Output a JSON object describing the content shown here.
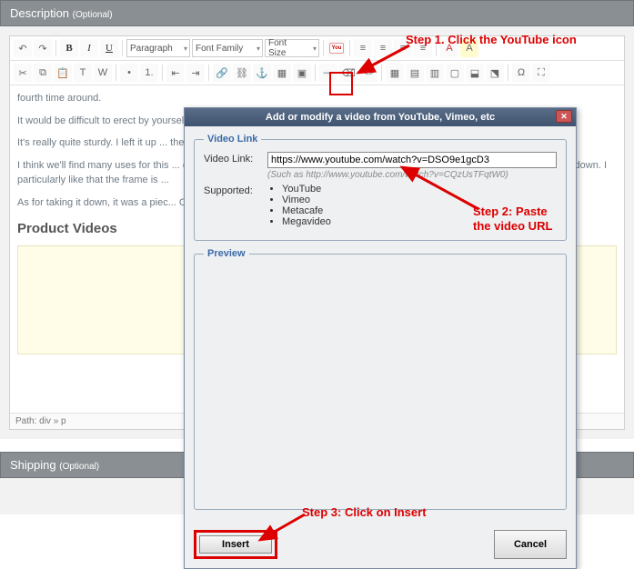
{
  "sections": {
    "description": {
      "title": "Description",
      "optional": "(Optional)"
    },
    "shipping": {
      "title": "Shipping",
      "optional": "(Optional)"
    }
  },
  "toolbar": {
    "paragraph": "Paragraph",
    "fontfamily": "Font Family",
    "fontsize": "Font Size"
  },
  "editor": {
    "p1": "fourth time around.",
    "p2": "It would be difficult to erect by yourself ...",
    "p3": "It's really quite sturdy. I left it up ... the day we erected it. Oh yes, I did stand u... might be worth investing in the walls!",
    "p4": "I think we'll find many uses for this ... of kid's birthday parties is keeping everyon... My 20 month old gave it a pretty good go... down. I particularly like that the frame is ...",
    "p5": "As for taking it down, it was a piec... Oh yes, an came. So much tidier ...",
    "product_videos": "Product Videos"
  },
  "pathbar": "Path: div » p",
  "dialog": {
    "title": "Add or modify a video from YouTube, Vimeo, etc",
    "legend_link": "Video Link",
    "label_link": "Video Link:",
    "input_value": "https://www.youtube.com/watch?v=DSO9e1gcD3",
    "hint": "(Such as http://www.youtube.com/watch?v=CQzUsTFqtW0)",
    "label_supported": "Supported:",
    "supported": [
      "YouTube",
      "Vimeo",
      "Metacafe",
      "Megavideo"
    ],
    "legend_preview": "Preview",
    "btn_insert": "Insert",
    "btn_cancel": "Cancel"
  },
  "annotations": {
    "step1": "Step 1. Click the YouTube icon",
    "step2a": "Step 2: Paste",
    "step2b": "the video URL",
    "step3": "Step 3: Click on Insert"
  }
}
